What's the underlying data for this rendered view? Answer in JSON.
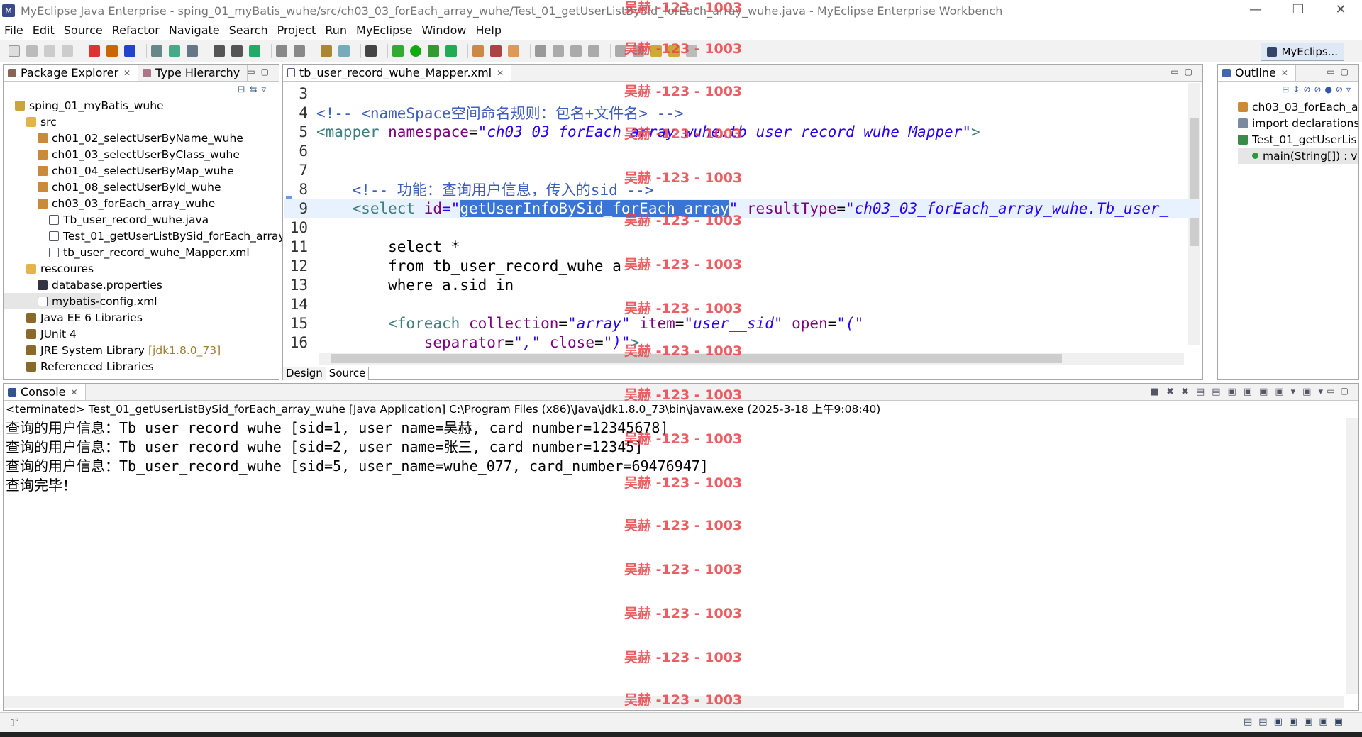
{
  "window": {
    "title": "MyEclipse Java Enterprise - sping_01_myBatis_wuhe/src/ch03_03_forEach_array_wuhe/Test_01_getUserListBySid_forEach_array_wuhe.java - MyEclipse Enterprise Workbench",
    "minimize": "—",
    "restore": "❐",
    "close": "✕"
  },
  "menu": [
    "File",
    "Edit",
    "Source",
    "Refactor",
    "Navigate",
    "Search",
    "Project",
    "Run",
    "MyEclipse",
    "Window",
    "Help"
  ],
  "perspective": {
    "label": "MyEclips..."
  },
  "package_explorer": {
    "tabs": [
      "Package Explorer",
      "Type Hierarchy"
    ],
    "items": [
      {
        "label": "sping_01_myBatis_wuhe",
        "icon": "project-icon",
        "level": 0
      },
      {
        "label": "src",
        "icon": "source-folder-icon",
        "level": 1
      },
      {
        "label": "ch01_02_selectUserByName_wuhe",
        "icon": "package-icon",
        "level": 2
      },
      {
        "label": "ch01_03_selectUserByClass_wuhe",
        "icon": "package-icon",
        "level": 2
      },
      {
        "label": "ch01_04_selectUserByMap_wuhe",
        "icon": "package-icon",
        "level": 2
      },
      {
        "label": "ch01_08_selectUserById_wuhe",
        "icon": "package-icon",
        "level": 2
      },
      {
        "label": "ch03_03_forEach_array_wuhe",
        "icon": "package-icon",
        "level": 2
      },
      {
        "label": "Tb_user_record_wuhe.java",
        "icon": "java-file-icon",
        "level": 3
      },
      {
        "label": "Test_01_getUserListBySid_forEach_array",
        "icon": "java-file-icon",
        "level": 3
      },
      {
        "label": "tb_user_record_wuhe_Mapper.xml",
        "icon": "xml-file-icon",
        "level": 3
      },
      {
        "label": "rescoures",
        "icon": "source-folder-icon",
        "level": 1
      },
      {
        "label": "database.properties",
        "icon": "properties-file-icon",
        "level": 2
      },
      {
        "label": "mybatis-config.xml",
        "icon": "xml-file-icon",
        "level": 2
      },
      {
        "label": "Java EE 6 Libraries",
        "icon": "library-icon",
        "level": 1
      },
      {
        "label": "JUnit 4",
        "icon": "library-icon",
        "level": 1
      },
      {
        "label": "JRE System Library",
        "icon": "library-icon",
        "level": 1,
        "suffix": "[jdk1.8.0_73]"
      },
      {
        "label": "Referenced Libraries",
        "icon": "library-icon",
        "level": 1
      }
    ]
  },
  "editor": {
    "tab": "tb_user_record_wuhe_Mapper.xml",
    "bottom_tabs": [
      "Design",
      "Source"
    ],
    "lines": [
      {
        "n": "3",
        "parts": []
      },
      {
        "n": "4",
        "parts": [
          {
            "t": "<!-- ",
            "c": "cmt"
          },
          {
            "t": "<nameSpace",
            "c": "cmt"
          },
          {
            "t": "空间命名规则：包名+文件名",
            "c": "cmt"
          },
          {
            "t": "> -->",
            "c": "cmt"
          }
        ]
      },
      {
        "n": "5",
        "parts": [
          {
            "t": "<mapper ",
            "c": "tag"
          },
          {
            "t": "namespace",
            "c": "attr"
          },
          {
            "t": "=",
            "c": "kw"
          },
          {
            "t": "\"ch03_03_forEach_array_wuhe.tb_user_record_wuhe_Mapper\"",
            "c": "val"
          },
          {
            "t": ">",
            "c": "tag"
          }
        ]
      },
      {
        "n": "6",
        "parts": []
      },
      {
        "n": "7",
        "parts": []
      },
      {
        "n": "8",
        "parts": [
          {
            "t": "    <!-- ",
            "c": "cmt"
          },
          {
            "t": "功能：查询用户信息，传入的",
            "c": "cmt"
          },
          {
            "t": "sid -->",
            "c": "cmt"
          }
        ]
      },
      {
        "n": "9",
        "hl": true,
        "parts": [
          {
            "t": "    <",
            "c": "tag"
          },
          {
            "t": "select",
            "c": "tag"
          },
          {
            "t": " id",
            "c": "attr"
          },
          {
            "t": "=\"",
            "c": "val"
          },
          {
            "t": "getUserInfoBySid_forEach_array",
            "c": "sel-text"
          },
          {
            "t": "\"",
            "c": "val"
          },
          {
            "t": " resultType",
            "c": "attr"
          },
          {
            "t": "=",
            "c": "kw"
          },
          {
            "t": "\"ch03_03_forEach_array_wuhe.Tb_user_",
            "c": "val"
          }
        ]
      },
      {
        "n": "10",
        "parts": []
      },
      {
        "n": "11",
        "parts": [
          {
            "t": "        select *",
            "c": "kw"
          }
        ]
      },
      {
        "n": "12",
        "parts": [
          {
            "t": "        from tb_user_record_wuhe a",
            "c": "kw"
          }
        ]
      },
      {
        "n": "13",
        "parts": [
          {
            "t": "        where a.sid in",
            "c": "kw"
          }
        ]
      },
      {
        "n": "14",
        "parts": []
      },
      {
        "n": "15",
        "parts": [
          {
            "t": "        <foreach ",
            "c": "tag"
          },
          {
            "t": "collection",
            "c": "attr"
          },
          {
            "t": "=",
            "c": "kw"
          },
          {
            "t": "\"array\"",
            "c": "val"
          },
          {
            "t": " item",
            "c": "attr"
          },
          {
            "t": "=",
            "c": "kw"
          },
          {
            "t": "\"user__sid\"",
            "c": "val"
          },
          {
            "t": " open",
            "c": "attr"
          },
          {
            "t": "=",
            "c": "kw"
          },
          {
            "t": "\"(\"",
            "c": "val"
          }
        ]
      },
      {
        "n": "16",
        "parts": [
          {
            "t": "            separator",
            "c": "attr"
          },
          {
            "t": "=",
            "c": "kw"
          },
          {
            "t": "\",\"",
            "c": "val"
          },
          {
            "t": " close",
            "c": "attr"
          },
          {
            "t": "=",
            "c": "kw"
          },
          {
            "t": "\")\"",
            "c": "val"
          },
          {
            "t": ">",
            "c": "tag"
          }
        ]
      }
    ]
  },
  "outline": {
    "tab": "Outline",
    "items": [
      {
        "label": "ch03_03_forEach_ar",
        "icon": "package-icon"
      },
      {
        "label": "import declarations",
        "icon": "import-icon"
      },
      {
        "label": "Test_01_getUserLis",
        "icon": "class-icon"
      },
      {
        "label": "main(String[]) : v",
        "icon": "method-icon"
      }
    ]
  },
  "console": {
    "tab": "Console",
    "status": "<terminated> Test_01_getUserListBySid_forEach_array_wuhe [Java Application] C:\\Program Files (x86)\\Java\\jdk1.8.0_73\\bin\\javaw.exe (2025-3-18 上午9:08:40)",
    "lines": [
      "查询的用户信息：Tb_user_record_wuhe [sid=1, user_name=吴赫, card_number=12345678]",
      "查询的用户信息：Tb_user_record_wuhe [sid=2, user_name=张三, card_number=12345]",
      "查询的用户信息：Tb_user_record_wuhe [sid=5, user_name=wuhe_077, card_number=69476947]",
      "查询完毕！"
    ]
  },
  "watermark": "吴赫 -123 - 1003"
}
